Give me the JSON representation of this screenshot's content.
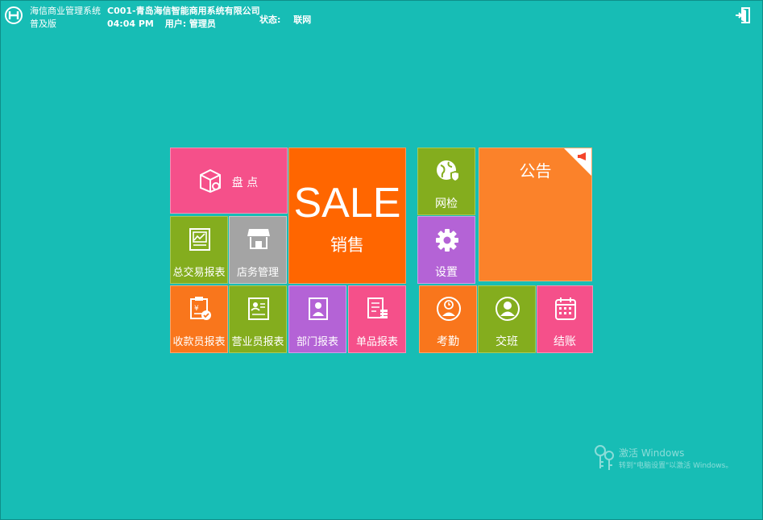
{
  "header": {
    "app_name": "海信商业管理系统",
    "edition": "普及版",
    "company": "C001-青岛海信智能商用系统有限公司",
    "time": "04:04 PM",
    "user": "用户: 管理员",
    "status_label": "状态:",
    "status_value": "联网"
  },
  "tiles": {
    "inventory": "盘 点",
    "sale_big": "SALE",
    "sale_sub": "销售",
    "total_report": "总交易报表",
    "store_mgmt": "店务管理",
    "cashier_report": "收款员报表",
    "salesperson_report": "营业员报表",
    "dept_report": "部门报表",
    "item_report": "单品报表",
    "network_check": "网检",
    "settings": "设置",
    "notice": "公告",
    "attendance": "考勤",
    "shift": "交班",
    "checkout": "结账"
  },
  "watermark": {
    "line1": "激活 Windows",
    "line2": "转到\"电脑设置\"以激活 Windows。"
  },
  "colors": {
    "background": "#17bdb5",
    "pink": "#f5508a",
    "green": "#84ad1e",
    "gray": "#a4a4a4",
    "orange": "#f9761c",
    "purple": "#b463d6",
    "sale": "#ff6600"
  }
}
